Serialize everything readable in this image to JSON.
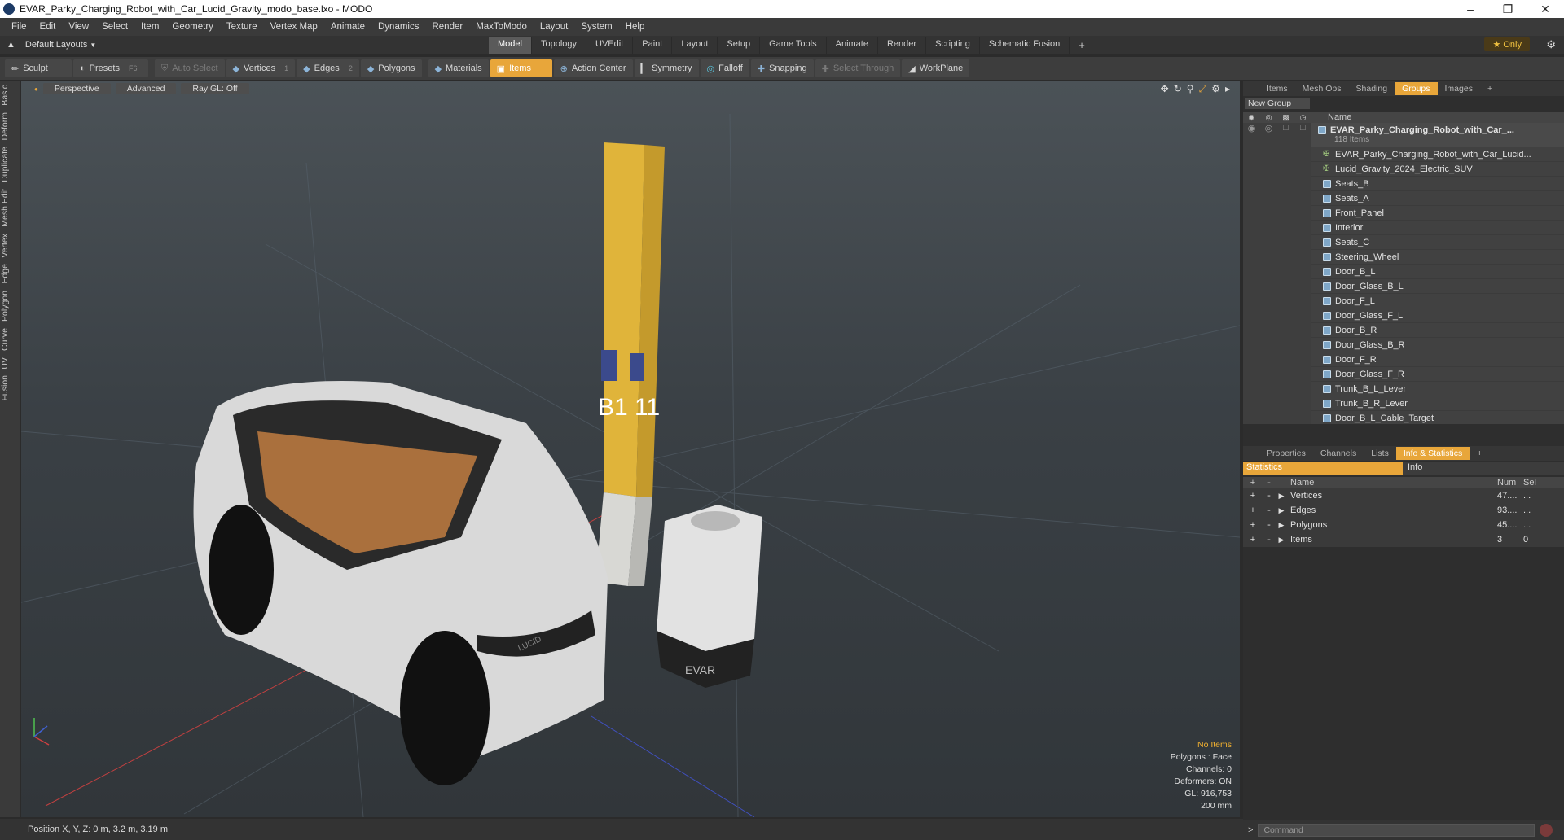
{
  "window": {
    "title": "EVAR_Parky_Charging_Robot_with_Car_Lucid_Gravity_modo_base.lxo - MODO"
  },
  "menu": [
    "File",
    "Edit",
    "View",
    "Select",
    "Item",
    "Geometry",
    "Texture",
    "Vertex Map",
    "Animate",
    "Dynamics",
    "Render",
    "MaxToModo",
    "Layout",
    "System",
    "Help"
  ],
  "layouts": {
    "label": "Default Layouts"
  },
  "layout_tabs": [
    "Model",
    "Topology",
    "UVEdit",
    "Paint",
    "Layout",
    "Setup",
    "Game Tools",
    "Animate",
    "Render",
    "Scripting",
    "Schematic Fusion"
  ],
  "layout_active": "Model",
  "only_label": "Only",
  "toolbar": {
    "sculpt": "Sculpt",
    "presets": "Presets",
    "presets_key": "F6",
    "auto_select": "Auto Select",
    "vertices": "Vertices",
    "vertices_key": "1",
    "edges": "Edges",
    "edges_key": "2",
    "polygons": "Polygons",
    "materials": "Materials",
    "items": "Items",
    "action_center": "Action Center",
    "symmetry": "Symmetry",
    "falloff": "Falloff",
    "snapping": "Snapping",
    "select_through": "Select Through",
    "workplane": "WorkPlane"
  },
  "left_tabs": [
    "Basic",
    "Deform",
    "Duplicate",
    "Mesh Edit",
    "Vertex",
    "Edge",
    "Polygon",
    "Curve",
    "UV",
    "Fusion"
  ],
  "viewport": {
    "view": "Perspective",
    "mode": "Advanced",
    "raygl": "Ray GL: Off",
    "info": {
      "no_items": "No Items",
      "polygons": "Polygons : Face",
      "channels": "Channels: 0",
      "deformers": "Deformers: ON",
      "gl": "GL: 916,753",
      "size": "200 mm"
    }
  },
  "status": {
    "position": "Position X, Y, Z:  0 m, 3.2 m, 3.19 m"
  },
  "groups_panel": {
    "tabs": [
      "Items",
      "Mesh Ops",
      "Shading",
      "Groups",
      "Images"
    ],
    "active": "Groups",
    "new_group": "New Group",
    "name_header": "Name",
    "root": {
      "name": "EVAR_Parky_Charging_Robot_with_Car_...",
      "count": "118 Items"
    },
    "items": [
      {
        "name": "EVAR_Parky_Charging_Robot_with_Car_Lucid...",
        "icon": "locator-icon"
      },
      {
        "name": "Lucid_Gravity_2024_Electric_SUV",
        "icon": "locator-icon"
      },
      {
        "name": "Seats_B",
        "icon": "mesh-icon"
      },
      {
        "name": "Seats_A",
        "icon": "mesh-icon"
      },
      {
        "name": "Front_Panel",
        "icon": "mesh-icon"
      },
      {
        "name": "Interior",
        "icon": "mesh-icon"
      },
      {
        "name": "Seats_C",
        "icon": "mesh-icon"
      },
      {
        "name": "Steering_Wheel",
        "icon": "mesh-icon"
      },
      {
        "name": "Door_B_L",
        "icon": "mesh-icon"
      },
      {
        "name": "Door_Glass_B_L",
        "icon": "mesh-icon"
      },
      {
        "name": "Door_F_L",
        "icon": "mesh-icon"
      },
      {
        "name": "Door_Glass_F_L",
        "icon": "mesh-icon"
      },
      {
        "name": "Door_B_R",
        "icon": "mesh-icon"
      },
      {
        "name": "Door_Glass_B_R",
        "icon": "mesh-icon"
      },
      {
        "name": "Door_F_R",
        "icon": "mesh-icon"
      },
      {
        "name": "Door_Glass_F_R",
        "icon": "mesh-icon"
      },
      {
        "name": "Trunk_B_L_Lever",
        "icon": "mesh-icon"
      },
      {
        "name": "Trunk_B_R_Lever",
        "icon": "mesh-icon"
      },
      {
        "name": "Door_B_L_Cable_Target",
        "icon": "mesh-icon"
      }
    ]
  },
  "stats_panel": {
    "tabs": [
      "Properties",
      "Channels",
      "Lists",
      "Info & Statistics"
    ],
    "active": "Info & Statistics",
    "sub_tabs": [
      "Statistics",
      "Info"
    ],
    "headers": {
      "name": "Name",
      "num": "Num",
      "sel": "Sel"
    },
    "rows": [
      {
        "name": "Vertices",
        "num": "47....",
        "sel": "..."
      },
      {
        "name": "Edges",
        "num": "93....",
        "sel": "..."
      },
      {
        "name": "Polygons",
        "num": "45....",
        "sel": "..."
      },
      {
        "name": "Items",
        "num": "3",
        "sel": "0"
      }
    ]
  },
  "command": {
    "placeholder": "Command"
  },
  "scene_text": {
    "pillar_label": "B1 11",
    "robot_brand": "EVAR",
    "car_brand": "LUCID"
  },
  "colors": {
    "accent": "#e8a63a",
    "pillar": "#e0b43a"
  }
}
